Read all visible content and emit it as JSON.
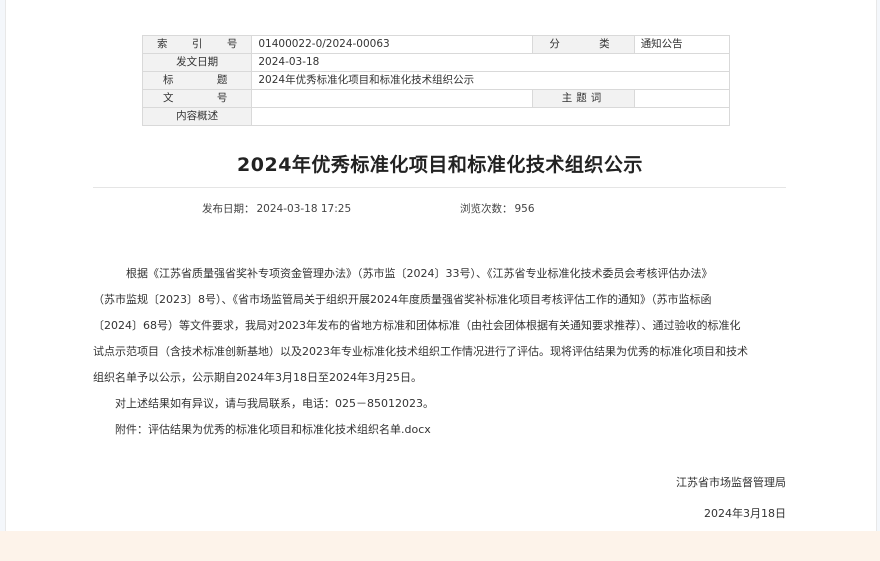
{
  "info_table": {
    "index_label": "索 引 号",
    "index_value": "01400022-0/2024-00063",
    "category_label": "分 类",
    "category_value": "通知公告",
    "date_label": "发文日期",
    "date_value": "2024-03-18",
    "title_label": "标 题",
    "title_value": "2024年优秀标准化项目和标准化技术组织公示",
    "docno_label": "文 号",
    "docno_value": "",
    "keyword_label": "主题词",
    "keyword_value": "",
    "summary_label": "内容概述",
    "summary_value": ""
  },
  "article": {
    "title": "2024年优秀标准化项目和标准化技术组织公示",
    "published_label": "发布日期：",
    "published_value": "2024-03-18 17:25",
    "views_label": "浏览次数：",
    "views_value": "956",
    "para1_l1": "根据《江苏省质量强省奖补专项资金管理办法》（苏市监〔2024〕33号）、《江苏省专业标准化技术委员会考核评估办法》",
    "para1_l2": "（苏市监规〔2023〕8号）、《省市场监管局关于组织开展2024年度质量强省奖补标准化项目考核评估工作的通知》（苏市监标函",
    "para1_l3": "〔2024〕68号）等文件要求，我局对2023年发布的省地方标准和团体标准（由社会团体根据有关通知要求推荐）、通过验收的标准化",
    "para1_l4": "试点示范项目（含技术标准创新基地）以及2023年专业标准化技术组织工作情况进行了评估。现将评估结果为优秀的标准化项目和技术",
    "para1_l5": "组织名单予以公示，公示期自2024年3月18日至2024年3月25日。",
    "para2": "对上述结果如有异议，请与我局联系，电话：025－85012023。",
    "attachment": "附件：评估结果为优秀的标准化项目和标准化技术组织名单.docx",
    "signature_org": "江苏省市场监督管理局",
    "signature_date": "2024年3月18日"
  }
}
